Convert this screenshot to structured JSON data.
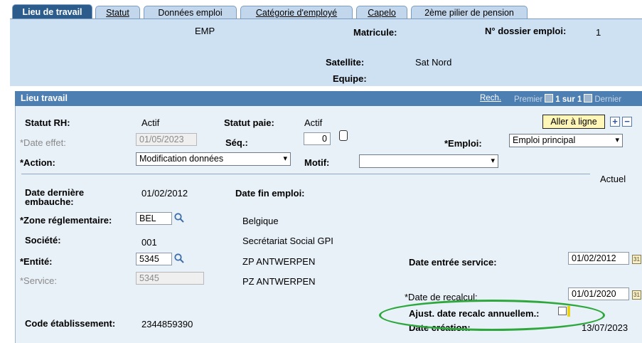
{
  "tabs": [
    {
      "label": "Lieu de travail",
      "active": true
    },
    {
      "label": "Statut",
      "active": false
    },
    {
      "label": "Données emploi",
      "active": false
    },
    {
      "label": "Catégorie d'employé",
      "active": false
    },
    {
      "label": "Capelo",
      "active": false
    },
    {
      "label": "2ème pilier de pension",
      "active": false
    }
  ],
  "header": {
    "emp_label": "EMP",
    "matricule_label": "Matricule:",
    "dossier_label": "N° dossier emploi:",
    "dossier_value": "1",
    "satellite_label": "Satellite:",
    "satellite_value": "Sat Nord",
    "equipe_label": "Equipe:"
  },
  "section": {
    "title": "Lieu travail",
    "rech": "Rech.",
    "premier": "Premier",
    "page_info": "1 sur 1",
    "dernier": "Dernier",
    "aller": "Aller à ligne",
    "add": "+",
    "remove": "−"
  },
  "form": {
    "statut_rh_label": "Statut RH:",
    "statut_rh_value": "Actif",
    "statut_paie_label": "Statut paie:",
    "statut_paie_value": "Actif",
    "date_effet_label": "*Date effet:",
    "date_effet_value": "01/05/2023",
    "seq_label": "Séq.:",
    "seq_value": "0",
    "emploi_label": "*Emploi:",
    "emploi_value": "Emploi principal",
    "action_label": "*Action:",
    "action_value": "Modification données",
    "motif_label": "Motif:",
    "motif_value": "",
    "actuel": "Actuel",
    "date_derniere_label": "Date dernière embauche:",
    "date_derniere_value": "01/02/2012",
    "date_fin_label": "Date fin emploi:",
    "zone_label": "*Zone réglementaire:",
    "zone_value": "BEL",
    "zone_desc": "Belgique",
    "societe_label": "Société:",
    "societe_value": "001",
    "societe_desc": "Secrétariat Social GPI",
    "entite_label": "*Entité:",
    "entite_value": "5345",
    "entite_desc": "ZP ANTWERPEN",
    "date_entree_label": "Date entrée service:",
    "date_entree_value": "01/02/2012",
    "service_label": "*Service:",
    "service_value": "5345",
    "service_desc": "PZ ANTWERPEN",
    "date_recalc_label": "*Date de recalcul:",
    "date_recalc_value": "01/01/2020",
    "ajust_label": "Ajust. date recalc annuellem.:",
    "code_etab_label": "Code établissement:",
    "code_etab_value": "2344859390",
    "date_creation_label": "Date création:",
    "date_creation_value": "13/07/2023"
  },
  "colors": {
    "tab_active": "#2c5c8c",
    "tab_inactive": "#c3d7ec",
    "header_band": "#cde1f3",
    "section_bar": "#4d7fb2",
    "panel_bg": "#e8f0f8",
    "highlight_oval": "#2ea83c"
  }
}
